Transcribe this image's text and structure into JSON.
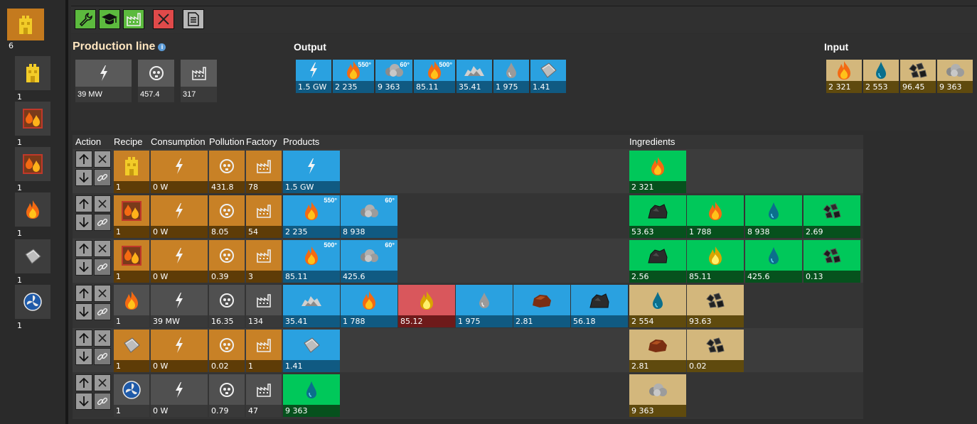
{
  "sidebar": {
    "items": [
      {
        "icon": "assembler-icon",
        "count": "6",
        "selected": true
      },
      {
        "icon": "assembler-icon",
        "count": "1",
        "selected": false
      },
      {
        "icon": "heat-exchanger-icon",
        "count": "1",
        "selected": false
      },
      {
        "icon": "heat-exchanger-icon",
        "count": "1",
        "selected": false
      },
      {
        "icon": "fire-icon",
        "count": "1",
        "selected": false
      },
      {
        "icon": "steel-plate-icon",
        "count": "1",
        "selected": false
      },
      {
        "icon": "pump-icon",
        "count": "1",
        "selected": false
      }
    ]
  },
  "toolbar": {
    "buttons": [
      "wrench-icon",
      "graduation-cap-icon",
      "factory-icon",
      "close-icon",
      "document-icon"
    ]
  },
  "summary": {
    "title": "Production line",
    "power": "39 MW",
    "pollution": "457.4",
    "factories": "317",
    "output_label": "Output",
    "input_label": "Input",
    "output": [
      {
        "icon": "lightning-icon",
        "value": "1.5 GW",
        "temp": ""
      },
      {
        "icon": "fire-icon",
        "value": "2 235",
        "temp": "550°"
      },
      {
        "icon": "steam-icon",
        "value": "9 363",
        "temp": "60°"
      },
      {
        "icon": "fire-icon",
        "value": "85.11",
        "temp": "500°"
      },
      {
        "icon": "ore-pile-icon",
        "value": "35.41",
        "temp": ""
      },
      {
        "icon": "drop-grey-icon",
        "value": "1 975",
        "temp": ""
      },
      {
        "icon": "steel-plate-icon",
        "value": "1.41",
        "temp": ""
      }
    ],
    "input": [
      {
        "icon": "fire-icon",
        "value": "2 321"
      },
      {
        "icon": "drop-blue-icon",
        "value": "2 553"
      },
      {
        "icon": "coal-icon",
        "value": "96.45"
      },
      {
        "icon": "steam-icon",
        "value": "9 363"
      }
    ]
  },
  "table": {
    "headers": {
      "action": "Action",
      "recipe": "Recipe",
      "consumption": "Consumption",
      "pollution": "Pollution",
      "factory": "Factory",
      "products": "Products",
      "ingredients": "Ingredients"
    },
    "rows": [
      {
        "recipe_icon": "assembler-icon",
        "recipe_count": "1",
        "orange": true,
        "consumption": "0 W",
        "pollution": "431.8",
        "factory": "78",
        "products": [
          {
            "icon": "lightning-icon",
            "value": "1.5 GW",
            "color": "blue",
            "temp": ""
          }
        ],
        "ingredients": [
          {
            "icon": "fire-icon",
            "value": "2 321",
            "color": "green"
          }
        ]
      },
      {
        "recipe_icon": "heat-exchanger-icon",
        "recipe_count": "1",
        "orange": true,
        "consumption": "0 W",
        "pollution": "8.05",
        "factory": "54",
        "products": [
          {
            "icon": "fire-icon",
            "value": "2 235",
            "color": "blue",
            "temp": "550°"
          },
          {
            "icon": "steam-icon",
            "value": "8 938",
            "color": "blue",
            "temp": "60°"
          }
        ],
        "ingredients": [
          {
            "icon": "coal-dark-icon",
            "value": "53.63",
            "color": "green"
          },
          {
            "icon": "fire-icon",
            "value": "1 788",
            "color": "green"
          },
          {
            "icon": "drop-blue-icon",
            "value": "8 938",
            "color": "green"
          },
          {
            "icon": "coal-icon",
            "value": "2.69",
            "color": "green"
          }
        ]
      },
      {
        "recipe_icon": "heat-exchanger-icon",
        "recipe_count": "1",
        "orange": true,
        "consumption": "0 W",
        "pollution": "0.39",
        "factory": "3",
        "products": [
          {
            "icon": "fire-icon",
            "value": "85.11",
            "color": "blue",
            "temp": "500°"
          },
          {
            "icon": "steam-icon",
            "value": "425.6",
            "color": "blue",
            "temp": "60°"
          }
        ],
        "ingredients": [
          {
            "icon": "coal-dark-icon",
            "value": "2.56",
            "color": "green"
          },
          {
            "icon": "fire-yellow-icon",
            "value": "85.11",
            "color": "green"
          },
          {
            "icon": "drop-blue-icon",
            "value": "425.6",
            "color": "green"
          },
          {
            "icon": "coal-icon",
            "value": "0.13",
            "color": "green"
          }
        ]
      },
      {
        "recipe_icon": "fire-icon",
        "recipe_count": "1",
        "orange": false,
        "consumption": "39 MW",
        "pollution": "16.35",
        "factory": "134",
        "products": [
          {
            "icon": "ore-pile-icon",
            "value": "35.41",
            "color": "blue",
            "temp": ""
          },
          {
            "icon": "fire-icon",
            "value": "1 788",
            "color": "blue",
            "temp": ""
          },
          {
            "icon": "fire-yellow-icon",
            "value": "85.12",
            "color": "red",
            "temp": ""
          },
          {
            "icon": "drop-grey-icon",
            "value": "1 975",
            "color": "blue",
            "temp": ""
          },
          {
            "icon": "rock-icon",
            "value": "2.81",
            "color": "blue",
            "temp": ""
          },
          {
            "icon": "coal-dark-icon",
            "value": "56.18",
            "color": "blue",
            "temp": ""
          }
        ],
        "ingredients": [
          {
            "icon": "drop-blue-icon",
            "value": "2 554",
            "color": "tan"
          },
          {
            "icon": "coal-icon",
            "value": "93.63",
            "color": "tan"
          }
        ]
      },
      {
        "recipe_icon": "steel-plate-icon",
        "recipe_count": "1",
        "orange": true,
        "consumption": "0 W",
        "pollution": "0.02",
        "factory": "1",
        "products": [
          {
            "icon": "steel-plate-icon",
            "value": "1.41",
            "color": "blue",
            "temp": ""
          }
        ],
        "ingredients": [
          {
            "icon": "rock-icon",
            "value": "2.81",
            "color": "tan"
          },
          {
            "icon": "coal-icon",
            "value": "0.02",
            "color": "tan"
          }
        ]
      },
      {
        "recipe_icon": "pump-icon",
        "recipe_count": "1",
        "orange": false,
        "consumption": "0 W",
        "pollution": "0.79",
        "factory": "47",
        "products": [
          {
            "icon": "drop-blue-icon",
            "value": "9 363",
            "color": "green",
            "temp": ""
          }
        ],
        "ingredients": [
          {
            "icon": "steam-icon",
            "value": "9 363",
            "color": "tan"
          }
        ]
      }
    ]
  }
}
